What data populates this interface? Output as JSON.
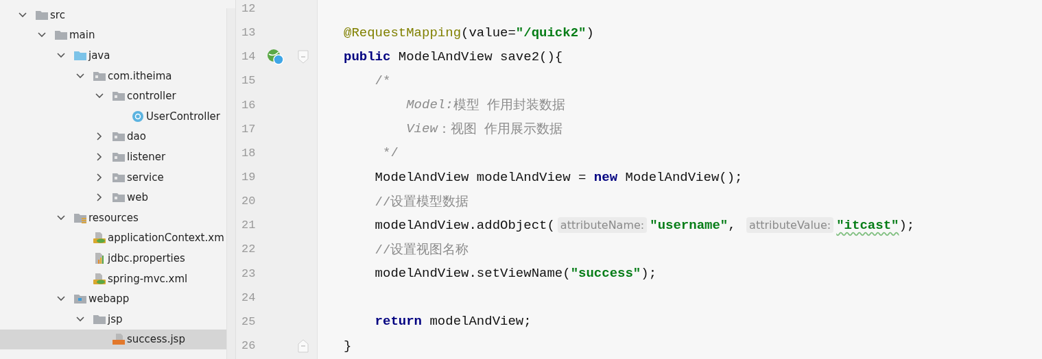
{
  "project_tree": {
    "items": [
      {
        "label": "src",
        "kind": "folder",
        "expanded": true,
        "selected": false,
        "children": [
          {
            "label": "main",
            "kind": "folder",
            "expanded": true,
            "selected": false,
            "children": [
              {
                "label": "java",
                "kind": "source-folder",
                "expanded": true,
                "selected": false,
                "children": [
                  {
                    "label": "com.itheima",
                    "kind": "package",
                    "expanded": true,
                    "selected": false,
                    "children": [
                      {
                        "label": "controller",
                        "kind": "package",
                        "expanded": true,
                        "selected": false,
                        "children": [
                          {
                            "label": "UserController",
                            "kind": "class",
                            "selected": false
                          }
                        ]
                      },
                      {
                        "label": "dao",
                        "kind": "package",
                        "expanded": false,
                        "selected": false
                      },
                      {
                        "label": "listener",
                        "kind": "package",
                        "expanded": false,
                        "selected": false
                      },
                      {
                        "label": "service",
                        "kind": "package",
                        "expanded": false,
                        "selected": false
                      },
                      {
                        "label": "web",
                        "kind": "package",
                        "expanded": false,
                        "selected": false
                      }
                    ]
                  }
                ]
              },
              {
                "label": "resources",
                "kind": "resource-folder",
                "expanded": true,
                "selected": false,
                "children": [
                  {
                    "label": "applicationContext.xm",
                    "kind": "xml",
                    "selected": false
                  },
                  {
                    "label": "jdbc.properties",
                    "kind": "properties",
                    "selected": false
                  },
                  {
                    "label": "spring-mvc.xml",
                    "kind": "xml",
                    "selected": false
                  }
                ]
              },
              {
                "label": "webapp",
                "kind": "web-folder",
                "expanded": true,
                "selected": false,
                "children": [
                  {
                    "label": "jsp",
                    "kind": "folder",
                    "expanded": true,
                    "selected": false,
                    "children": [
                      {
                        "label": "success.jsp",
                        "kind": "jsp",
                        "selected": true
                      }
                    ]
                  }
                ]
              }
            ]
          }
        ]
      }
    ]
  },
  "editor": {
    "lines": [
      {
        "number": "12"
      },
      {
        "number": "13",
        "tokens": [
          {
            "kind": "annotation",
            "text": "@RequestMapping"
          },
          {
            "kind": "plain",
            "text": "(value="
          },
          {
            "kind": "string",
            "text": "\"/quick2\""
          },
          {
            "kind": "plain",
            "text": ")"
          }
        ]
      },
      {
        "number": "14",
        "gutter_marker": true,
        "fold_start": true,
        "tokens": [
          {
            "kind": "keyword",
            "text": "public"
          },
          {
            "kind": "plain",
            "text": " ModelAndView save2(){"
          }
        ]
      },
      {
        "number": "15",
        "tokens": [
          {
            "kind": "comment",
            "text": "    /*"
          }
        ]
      },
      {
        "number": "16",
        "tokens": [
          {
            "kind": "comment-italic",
            "text": "        Model:"
          },
          {
            "kind": "comment",
            "text": "模型 作用封装数据"
          }
        ]
      },
      {
        "number": "17",
        "tokens": [
          {
            "kind": "comment-italic",
            "text": "        View"
          },
          {
            "kind": "comment",
            "text": "：视图 作用展示数据"
          }
        ]
      },
      {
        "number": "18",
        "tokens": [
          {
            "kind": "comment",
            "text": "     */"
          }
        ]
      },
      {
        "number": "19",
        "tokens": [
          {
            "kind": "plain",
            "text": "    ModelAndView modelAndView = "
          },
          {
            "kind": "keyword",
            "text": "new"
          },
          {
            "kind": "plain",
            "text": " ModelAndView();"
          }
        ]
      },
      {
        "number": "20",
        "tokens": [
          {
            "kind": "comment",
            "text": "    //设置模型数据"
          }
        ]
      },
      {
        "number": "21",
        "tokens": [
          {
            "kind": "plain",
            "text": "    modelAndView.addObject("
          },
          {
            "kind": "hint",
            "text": "attributeName:"
          },
          {
            "kind": "string",
            "text": "\"username\""
          },
          {
            "kind": "plain",
            "text": ", "
          },
          {
            "kind": "hint",
            "text": "attributeValue:"
          },
          {
            "kind": "string",
            "text": "\"itcast\"",
            "typo": true
          },
          {
            "kind": "plain",
            "text": ");"
          }
        ]
      },
      {
        "number": "22",
        "tokens": [
          {
            "kind": "comment",
            "text": "    //设置视图名称"
          }
        ]
      },
      {
        "number": "23",
        "tokens": [
          {
            "kind": "plain",
            "text": "    modelAndView.setViewName("
          },
          {
            "kind": "string",
            "text": "\"success\""
          },
          {
            "kind": "plain",
            "text": ");"
          }
        ]
      },
      {
        "number": "24"
      },
      {
        "number": "25",
        "tokens": [
          {
            "kind": "keyword",
            "text": "    return"
          },
          {
            "kind": "plain",
            "text": " modelAndView;"
          }
        ]
      },
      {
        "number": "26",
        "fold_end": true,
        "tokens": [
          {
            "kind": "plain",
            "text": "}"
          }
        ]
      }
    ]
  }
}
